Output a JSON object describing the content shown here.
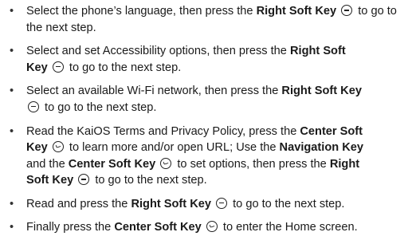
{
  "bullet_glyph": "•",
  "keys": {
    "right_soft_key": "Right Soft Key",
    "right_soft": "Right Soft",
    "key": "Key",
    "center_soft_key": "Center Soft Key",
    "center_soft": "Center Soft",
    "navigation_key": "Navigation Key",
    "right": "Right",
    "soft_key": "Soft Key",
    "right_icon": "right-soft-key-icon",
    "center_icon": "center-soft-key-icon"
  },
  "steps": [
    {
      "before": "Select the phone’s language, then press the ",
      "after": " to go to the next step."
    },
    {
      "before": "Select and set Accessibility options, then press the ",
      "after": " to go to the next step."
    },
    {
      "before": "Select an available Wi-Fi network, then press the ",
      "after": " to go to the next step."
    },
    {
      "t1": "Read the KaiOS Terms and Privacy Policy, press the ",
      "t2": " to learn more and/or open URL; Use the ",
      "t3": " and the ",
      "t4": " to set options, then press the ",
      "t5": " to go to the next step."
    },
    {
      "before": "Read and press the ",
      "after": " to go to the next step."
    },
    {
      "before": "Finally press the ",
      "after": " to enter the Home screen."
    }
  ]
}
